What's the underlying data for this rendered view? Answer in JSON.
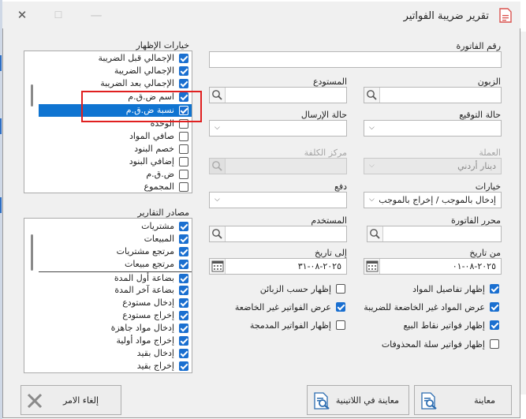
{
  "window": {
    "title": "تقرير ضريبة الفواتير"
  },
  "titlebar": {
    "minimize": "—",
    "restore": "☐",
    "close": "✕"
  },
  "fields": {
    "invoice_number": {
      "label": "رقم الفاتورة",
      "value": ""
    },
    "customer": {
      "label": "الزبون",
      "value": ""
    },
    "warehouse": {
      "label": "المستودع",
      "value": ""
    },
    "signature_status": {
      "label": "حالة التوقيع",
      "value": ""
    },
    "send_status": {
      "label": "حالة الإرسال",
      "value": ""
    },
    "currency": {
      "label": "العملة",
      "value": "دينار أردني"
    },
    "cost_center": {
      "label": "مركز الكلفة",
      "value": ""
    },
    "options": {
      "label": "خيارات",
      "value": "إدخال بالموجب / إخراج بالموجب"
    },
    "payment": {
      "label": "دفع",
      "value": ""
    },
    "invoice_editor": {
      "label": "محرر الفاتورة",
      "value": ""
    },
    "user": {
      "label": "المستخدم",
      "value": ""
    },
    "date_from": {
      "label": "من تاريخ",
      "value": "٢٠٢٥-٠٨-٠١"
    },
    "date_to": {
      "label": "إلى تاريخ",
      "value": "٢٠٢٥-٠٨-٣١"
    }
  },
  "checkboxes": [
    {
      "label": "إظهار تفاصيل المواد",
      "checked": true
    },
    {
      "label": "إظهار حسب الزبائن",
      "checked": false
    },
    {
      "label": "عرض المواد غير الخاضعة للضريبة",
      "checked": true
    },
    {
      "label": "عرض الفواتير غير الخاضعة",
      "checked": true
    },
    {
      "label": "إظهار فواتير نقاط البيع",
      "checked": true
    },
    {
      "label": "إظهار الفواتير المدمجة",
      "checked": false
    },
    {
      "label": "إظهار فواتير سلة المحذوفات",
      "checked": false
    }
  ],
  "display_options": {
    "title": "خيارات الإظهار",
    "items": [
      {
        "label": "الإجمالي قبل الضريبة",
        "checked": true
      },
      {
        "label": "الإجمالي الضريبة",
        "checked": true
      },
      {
        "label": "الإجمالي بعد الضريبة",
        "checked": true
      },
      {
        "label": "اسم ض.ق.م",
        "checked": true
      },
      {
        "label": "نسبة ض.ق.م",
        "checked": true,
        "selected": true
      },
      {
        "label": "الوحدة",
        "checked": false
      },
      {
        "label": "صافي المواد",
        "checked": false
      },
      {
        "label": "خصم البنود",
        "checked": false
      },
      {
        "label": "إضافي البنود",
        "checked": false
      },
      {
        "label": "ض.ق.م",
        "checked": false
      },
      {
        "label": "المجموع",
        "checked": false
      }
    ]
  },
  "report_sources": {
    "title": "مصادر التقارير",
    "items": [
      {
        "label": "مشتريات",
        "checked": true
      },
      {
        "label": "المبيعات",
        "checked": true
      },
      {
        "label": "مرتجع مشتريات",
        "checked": true
      },
      {
        "label": "مرتجع مبيعات",
        "checked": true
      },
      {
        "label": "بضاعة أول المدة",
        "checked": true
      },
      {
        "label": "بضاعة آخر المدة",
        "checked": true
      },
      {
        "label": "إدخال مستودع",
        "checked": true
      },
      {
        "label": "إخراج مستودع",
        "checked": true
      },
      {
        "label": "إدخال مواد جاهزة",
        "checked": true
      },
      {
        "label": "إخراج مواد أولية",
        "checked": true
      },
      {
        "label": "إدخال بقيد",
        "checked": true
      },
      {
        "label": "إخراج بقيد",
        "checked": true
      }
    ]
  },
  "buttons": {
    "preview": "معاينة",
    "preview_latin": "معاينة في اللاتينية",
    "cancel": "إلغاء الامر"
  },
  "colors": {
    "selection": "#0f74d1",
    "check": "#1a6fd0",
    "highlight": "#e02020"
  }
}
